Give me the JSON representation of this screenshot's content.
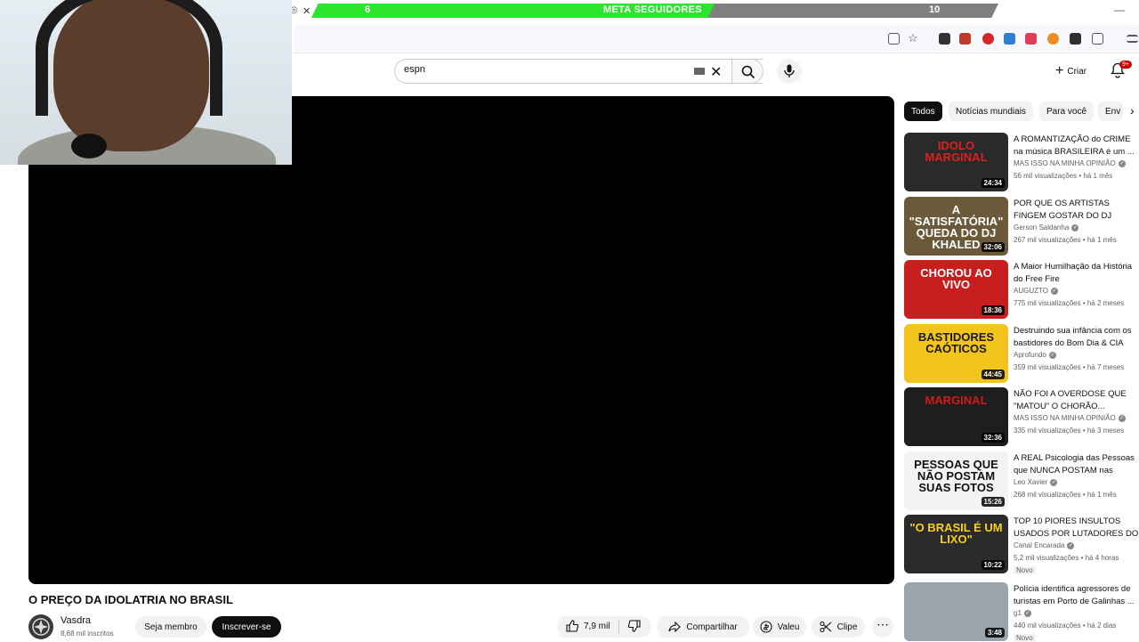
{
  "goal_bar": {
    "start": "6",
    "label": "META SEGUIDORES",
    "end": "10",
    "progress": 0.587,
    "fill_color": "#2ee52e"
  },
  "search": {
    "value": "espn"
  },
  "header": {
    "create_label": "Criar",
    "notifications_badge": "9+"
  },
  "video": {
    "title": "O PREÇO DA IDOLATRIA NO BRASIL",
    "channel": "Vasdra",
    "subscribers": "8,68 mil inscritos",
    "member_label": "Seja membro",
    "subscribe_label": "Inscrever-se",
    "likes": "7,9 mil",
    "share_label": "Compartilhar",
    "thanks_label": "Valeu",
    "clip_label": "Clipe"
  },
  "chips": [
    "Todos",
    "Notícias mundiais",
    "Para você",
    "Env"
  ],
  "recommendations": [
    {
      "title": "A ROMANTIZAÇÃO do CRIME na música BRASILEIRA é um ...",
      "channel": "MAS ISSO NA MINHA OPINIÃO",
      "meta": "56 mil visualizações • há 1 mês",
      "duration": "24:34",
      "thumb_text": "IDOLO MARGINAL",
      "thumb_bg": "#2a2a2a",
      "thumb_fg": "#e02020",
      "badge": ""
    },
    {
      "title": "POR QUE OS ARTISTAS FINGEM GOSTAR DO DJ KHALED?",
      "channel": "Gerson Saldanha",
      "meta": "267 mil visualizações • há 1 mês",
      "duration": "32:06",
      "thumb_text": "A \"SATISFATÓRIA\" QUEDA DO DJ KHALED",
      "thumb_bg": "#6b5a3a",
      "thumb_fg": "#ffffff",
      "badge": ""
    },
    {
      "title": "A Maior Humilhação da História do Free Fire",
      "channel": "AUGUZTO",
      "meta": "775 mil visualizações • há 2 meses",
      "duration": "18:36",
      "thumb_text": "CHOROU AO VIVO",
      "thumb_bg": "#c81e1e",
      "thumb_fg": "#ffffff",
      "badge": ""
    },
    {
      "title": "Destruindo sua infância com os bastidores do Bom Dia & CIA",
      "channel": "Aprofundo",
      "meta": "359 mil visualizações • há 7 meses",
      "duration": "44:45",
      "thumb_text": "BASTIDORES CAÓTICOS",
      "thumb_bg": "#f2c51c",
      "thumb_fg": "#1a1a1a",
      "badge": ""
    },
    {
      "title": "NÃO FOI A OVERDOSE QUE \"MATOU\" O CHORÃO...",
      "channel": "MAS ISSO NA MINHA OPINIÃO",
      "meta": "335 mil visualizações • há 3 meses",
      "duration": "32:36",
      "thumb_text": "MARGINAL",
      "thumb_bg": "#1e1e1e",
      "thumb_fg": "#d11a1a",
      "badge": ""
    },
    {
      "title": "A REAL Psicologia das Pessoas que NUNCA POSTAM nas rede...",
      "channel": "Leo Xavier",
      "meta": "268 mil visualizações • há 1 mês",
      "duration": "15:26",
      "thumb_text": "PESSOAS QUE NÃO POSTAM SUAS FOTOS",
      "thumb_bg": "#f3f3f3",
      "thumb_fg": "#111111",
      "badge": ""
    },
    {
      "title": "TOP 10 PIORES INSULTOS USADOS POR LUTADORES DO ...",
      "channel": "Canal Encarada",
      "meta": "5,2 mil visualizações • há 4 horas",
      "duration": "10:22",
      "thumb_text": "\"O BRASIL É UM LIXO\"",
      "thumb_bg": "#2b2b2b",
      "thumb_fg": "#f5d11a",
      "badge": "Novo"
    },
    {
      "title": "Polícia identifica agressores de turistas em Porto de Galinhas ...",
      "channel": "g1",
      "meta": "440 mil visualizações • há 2 dias",
      "duration": "3:48",
      "thumb_text": "",
      "thumb_bg": "#9aa4ad",
      "thumb_fg": "#ffffff",
      "badge": "Novo"
    }
  ]
}
